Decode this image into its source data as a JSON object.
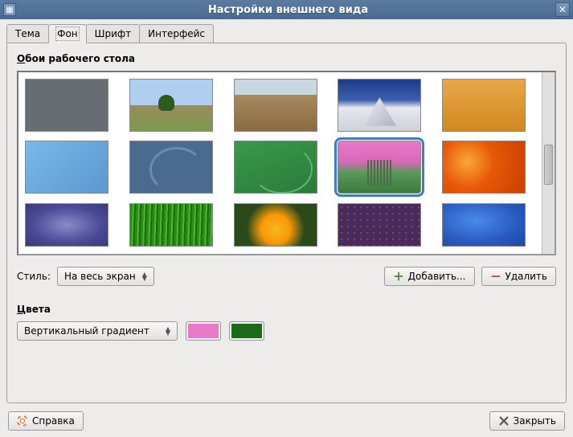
{
  "titlebar": {
    "title": "Настройки внешнего вида"
  },
  "tabs": {
    "theme": "Тема",
    "background": "Фон",
    "font": "Шрифт",
    "interface": "Интерфейс"
  },
  "wallpaper": {
    "section_label_u": "О",
    "section_label_rest": "бои рабочего стола",
    "items": [
      {
        "id": "wp1",
        "name": "solid-gray"
      },
      {
        "id": "wp2",
        "name": "countryside-path"
      },
      {
        "id": "wp3",
        "name": "canyon"
      },
      {
        "id": "wp4",
        "name": "mountain-peak"
      },
      {
        "id": "wp5",
        "name": "orange-gradient"
      },
      {
        "id": "wp6",
        "name": "blue-gradient"
      },
      {
        "id": "wp7",
        "name": "debian-swirl-blue"
      },
      {
        "id": "wp8",
        "name": "green-swirl"
      },
      {
        "id": "wp9",
        "name": "pink-green-plants",
        "selected": true
      },
      {
        "id": "wp10",
        "name": "orange-flower-macro"
      },
      {
        "id": "wp11",
        "name": "purple-wave"
      },
      {
        "id": "wp12",
        "name": "green-grass"
      },
      {
        "id": "wp13",
        "name": "yellow-flower"
      },
      {
        "id": "wp14",
        "name": "purple-dots"
      },
      {
        "id": "wp15",
        "name": "blue-wave"
      }
    ]
  },
  "style": {
    "label_u": "С",
    "label_rest": "тиль:",
    "value": "На весь экран",
    "add": "Добавить...",
    "remove": "Удалить"
  },
  "colors": {
    "label_u": "Ц",
    "label_rest": "вета",
    "gradient_type": "Вертикальный градиент",
    "color1": "#e878c8",
    "color2": "#1a6a1a"
  },
  "footer": {
    "help": "Справка",
    "close": "Закрыть"
  }
}
